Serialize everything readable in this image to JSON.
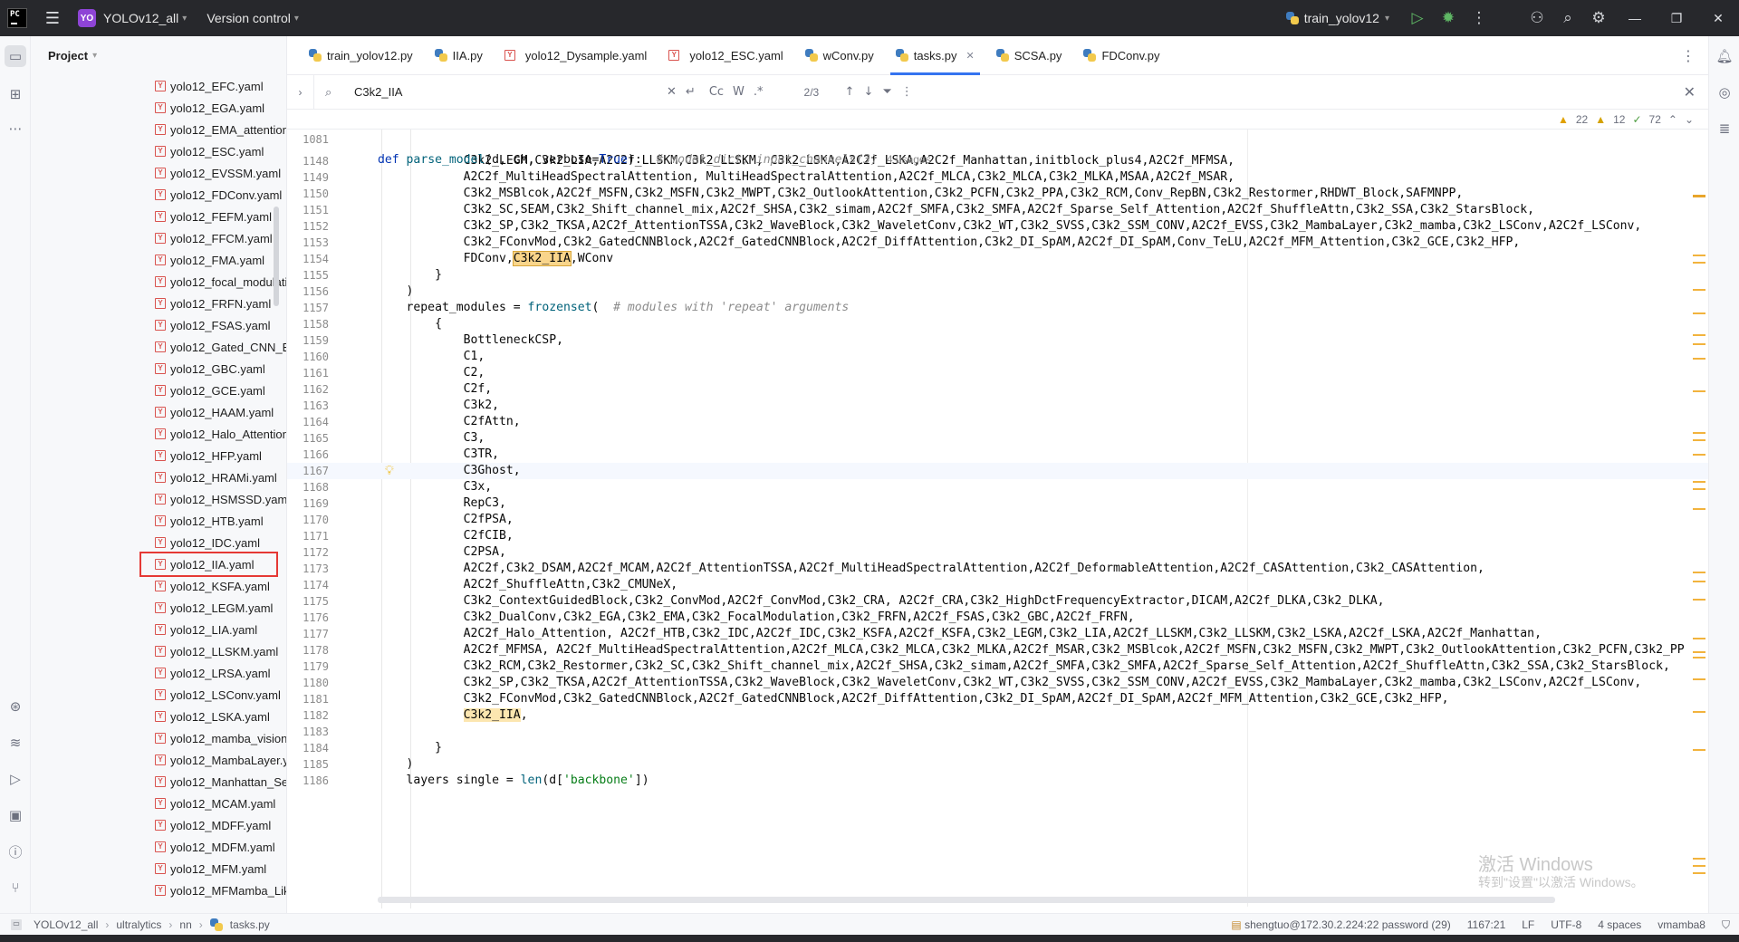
{
  "titlebar": {
    "logo": "PC",
    "project_badge": "YO",
    "project_name": "YOLOv12_all",
    "vcs_label": "Version control",
    "run_config": "train_yolov12"
  },
  "project_panel": {
    "title": "Project",
    "files": [
      "yolo12_EFC.yaml",
      "yolo12_EGA.yaml",
      "yolo12_EMA_attention.",
      "yolo12_ESC.yaml",
      "yolo12_EVSSM.yaml",
      "yolo12_FDConv.yaml",
      "yolo12_FEFM.yaml",
      "yolo12_FFCM.yaml",
      "yolo12_FMA.yaml",
      "yolo12_focal_modulati",
      "yolo12_FRFN.yaml",
      "yolo12_FSAS.yaml",
      "yolo12_Gated_CNN_Bl",
      "yolo12_GBC.yaml",
      "yolo12_GCE.yaml",
      "yolo12_HAAM.yaml",
      "yolo12_Halo_Attention",
      "yolo12_HFP.yaml",
      "yolo12_HRAMi.yaml",
      "yolo12_HSMSSD.yaml",
      "yolo12_HTB.yaml",
      "yolo12_IDC.yaml",
      "yolo12_IIA.yaml",
      "yolo12_KSFA.yaml",
      "yolo12_LEGM.yaml",
      "yolo12_LIA.yaml",
      "yolo12_LLSKM.yaml",
      "yolo12_LRSA.yaml",
      "yolo12_LSConv.yaml",
      "yolo12_LSKA.yaml",
      "yolo12_mamba_vision.",
      "yolo12_MambaLayer.y",
      "yolo12_Manhattan_Sel",
      "yolo12_MCAM.yaml",
      "yolo12_MDFF.yaml",
      "yolo12_MDFM.yaml",
      "yolo12_MFM.yaml",
      "yolo12_MFMamba_Lik"
    ],
    "highlighted_file": "yolo12_IIA.yaml"
  },
  "tabs": [
    {
      "label": "train_yolov12.py",
      "type": "py",
      "active": false
    },
    {
      "label": "IIA.py",
      "type": "py",
      "active": false
    },
    {
      "label": "yolo12_Dysample.yaml",
      "type": "yaml",
      "active": false
    },
    {
      "label": "yolo12_ESC.yaml",
      "type": "yaml",
      "active": false
    },
    {
      "label": "wConv.py",
      "type": "py",
      "active": false
    },
    {
      "label": "tasks.py",
      "type": "py",
      "active": true
    },
    {
      "label": "SCSA.py",
      "type": "py",
      "active": false
    },
    {
      "label": "FDConv.py",
      "type": "py",
      "active": false
    }
  ],
  "find": {
    "query": "C3k2_IIA",
    "match_case": "Cc",
    "words": "W",
    "regex": ".*",
    "count": "2/3"
  },
  "inspections": {
    "warnings": "22",
    "weak_warnings": "12",
    "ok": "72"
  },
  "sticky_line": {
    "number": "1081",
    "def_kw": "def",
    "fn_name": "parse_model",
    "params": "(d, ch, verbose=",
    "true_kw": "True",
    "tail": "):",
    "comment": "# model_dict, input_channels(3)",
    "usages": "4 usages"
  },
  "code_lines": [
    {
      "n": "1148",
      "t": "            C3k2_LEGM,C3k2_LIA,A2C2f_LLSKM,C3k2_LLSKM, C3k2_LSKA,A2C2f_LSKA,A2C2f_Manhattan,initblock_plus4,A2C2f_MFMSA,"
    },
    {
      "n": "1149",
      "t": "            A2C2f_MultiHeadSpectralAttention, MultiHeadSpectralAttention,A2C2f_MLCA,C3k2_MLCA,C3k2_MLKA,MSAA,A2C2f_MSAR,"
    },
    {
      "n": "1150",
      "t": "            C3k2_MSBlcok,A2C2f_MSFN,C3k2_MSFN,C3k2_MWPT,C3k2_OutlookAttention,C3k2_PCFN,C3k2_PPA,C3k2_RCM,Conv_RepBN,C3k2_Restormer,RHDWT_Block,SAFMNPP,"
    },
    {
      "n": "1151",
      "t": "            C3k2_SC,SEAM,C3k2_Shift_channel_mix,A2C2f_SHSA,C3k2_simam,A2C2f_SMFA,C3k2_SMFA,A2C2f_Sparse_Self_Attention,A2C2f_ShuffleAttn,C3k2_SSA,C3k2_StarsBlock,"
    },
    {
      "n": "1152",
      "t": "            C3k2_SP,C3k2_TKSA,A2C2f_AttentionTSSA,C3k2_WaveBlock,C3k2_WaveletConv,C3k2_WT,C3k2_SVSS,C3k2_SSM_CONV,A2C2f_EVSS,C3k2_MambaLayer,C3k2_mamba,C3k2_LSConv,A2C2f_LSConv,"
    },
    {
      "n": "1153",
      "t": "            C3k2_FConvMod,C3k2_GatedCNNBlock,A2C2f_GatedCNNBlock,A2C2f_DiffAttention,C3k2_DI_SpAM,A2C2f_DI_SpAM,Conv_TeLU,A2C2f_MFM_Attention,C3k2_GCE,C3k2_HFP,"
    },
    {
      "n": "1154",
      "t": "            FDConv,",
      "hl": "C3k2_IIA",
      "after": ",WConv"
    },
    {
      "n": "1155",
      "t": "        }"
    },
    {
      "n": "1156",
      "t": "    )"
    },
    {
      "n": "1157",
      "t": "    repeat_modules = ",
      "fn": "frozenset",
      "after": "(  ",
      "cm": "# modules with 'repeat' arguments"
    },
    {
      "n": "1158",
      "t": "        {"
    },
    {
      "n": "1159",
      "t": "            BottleneckCSP,"
    },
    {
      "n": "1160",
      "t": "            C1,"
    },
    {
      "n": "1161",
      "t": "            C2,"
    },
    {
      "n": "1162",
      "t": "            C2f,"
    },
    {
      "n": "1163",
      "t": "            C3k2,"
    },
    {
      "n": "1164",
      "t": "            C2fAttn,"
    },
    {
      "n": "1165",
      "t": "            C3,"
    },
    {
      "n": "1166",
      "t": "            C3TR,"
    },
    {
      "n": "1167",
      "t": "            C3Ghost,",
      "current": true
    },
    {
      "n": "1168",
      "t": "            C3x,"
    },
    {
      "n": "1169",
      "t": "            RepC3,"
    },
    {
      "n": "1170",
      "t": "            C2fPSA,"
    },
    {
      "n": "1171",
      "t": "            C2fCIB,"
    },
    {
      "n": "1172",
      "t": "            C2PSA,"
    },
    {
      "n": "1173",
      "t": "            A2C2f,C3k2_DSAM,A2C2f_MCAM,A2C2f_AttentionTSSA,A2C2f_MultiHeadSpectralAttention,A2C2f_DeformableAttention,A2C2f_CASAttention,C3k2_CASAttention,"
    },
    {
      "n": "1174",
      "t": "            A2C2f_ShuffleAttn,C3k2_CMUNeX,"
    },
    {
      "n": "1175",
      "t": "            C3k2_ContextGuidedBlock,C3k2_ConvMod,A2C2f_ConvMod,C3k2_CRA, A2C2f_CRA,C3k2_HighDctFrequencyExtractor,DICAM,A2C2f_DLKA,C3k2_DLKA,"
    },
    {
      "n": "1176",
      "t": "            C3k2_DualConv,C3k2_EGA,C3k2_EMA,C3k2_FocalModulation,C3k2_FRFN,A2C2f_FSAS,C3k2_GBC,A2C2f_FRFN,"
    },
    {
      "n": "1177",
      "t": "            A2C2f_Halo_Attention, A2C2f_HTB,C3k2_IDC,A2C2f_IDC,C3k2_KSFA,A2C2f_KSFA,C3k2_LEGM,C3k2_LIA,A2C2f_LLSKM,C3k2_LLSKM,C3k2_LSKA,A2C2f_LSKA,A2C2f_Manhattan,"
    },
    {
      "n": "1178",
      "t": "            A2C2f_MFMSA, A2C2f_MultiHeadSpectralAttention,A2C2f_MLCA,C3k2_MLCA,C3k2_MLKA,A2C2f_MSAR,C3k2_MSBlcok,A2C2f_MSFN,C3k2_MSFN,C3k2_MWPT,C3k2_OutlookAttention,C3k2_PCFN,C3k2_PP"
    },
    {
      "n": "1179",
      "t": "            C3k2_RCM,C3k2_Restormer,C3k2_SC,C3k2_Shift_channel_mix,A2C2f_SHSA,C3k2_simam,A2C2f_SMFA,C3k2_SMFA,A2C2f_Sparse_Self_Attention,A2C2f_ShuffleAttn,C3k2_SSA,C3k2_StarsBlock,"
    },
    {
      "n": "1180",
      "t": "            C3k2_SP,C3k2_TKSA,A2C2f_AttentionTSSA,C3k2_WaveBlock,C3k2_WaveletConv,C3k2_WT,C3k2_SVSS,C3k2_SSM_CONV,A2C2f_EVSS,C3k2_MambaLayer,C3k2_mamba,C3k2_LSConv,A2C2f_LSConv,"
    },
    {
      "n": "1181",
      "t": "            C3k2_FConvMod,C3k2_GatedCNNBlock,A2C2f_GatedCNNBlock,A2C2f_DiffAttention,C3k2_DI_SpAM,A2C2f_DI_SpAM,A2C2f_MFM_Attention,C3k2_GCE,C3k2_HFP,"
    },
    {
      "n": "1182",
      "t": "            ",
      "hl2": "C3k2_IIA",
      "after": ","
    },
    {
      "n": "1183",
      "t": ""
    },
    {
      "n": "1184",
      "t": "        }"
    },
    {
      "n": "1185",
      "t": "    )"
    },
    {
      "n": "1186",
      "t": "    layers single = ",
      "fn": "len",
      "after": "(d[",
      "str": "'backbone'",
      "after2": "])"
    }
  ],
  "watermark": {
    "line1": "激活 Windows",
    "line2": "转到\"设置\"以激活 Windows。"
  },
  "statusbar": {
    "crumbs": [
      "YOLOv12_all",
      "ultralytics",
      "nn",
      "tasks.py"
    ],
    "remote": "shengtuo@172.30.2.224:22 password (29)",
    "position": "1167:21",
    "line_sep": "LF",
    "encoding": "UTF-8",
    "indent": "4 spaces",
    "interpreter": "vmamba8"
  },
  "colors": {
    "accent": "#3574f0",
    "highlight": "#f9d58b",
    "titlebar": "#27282c",
    "warning": "#e0a100"
  }
}
